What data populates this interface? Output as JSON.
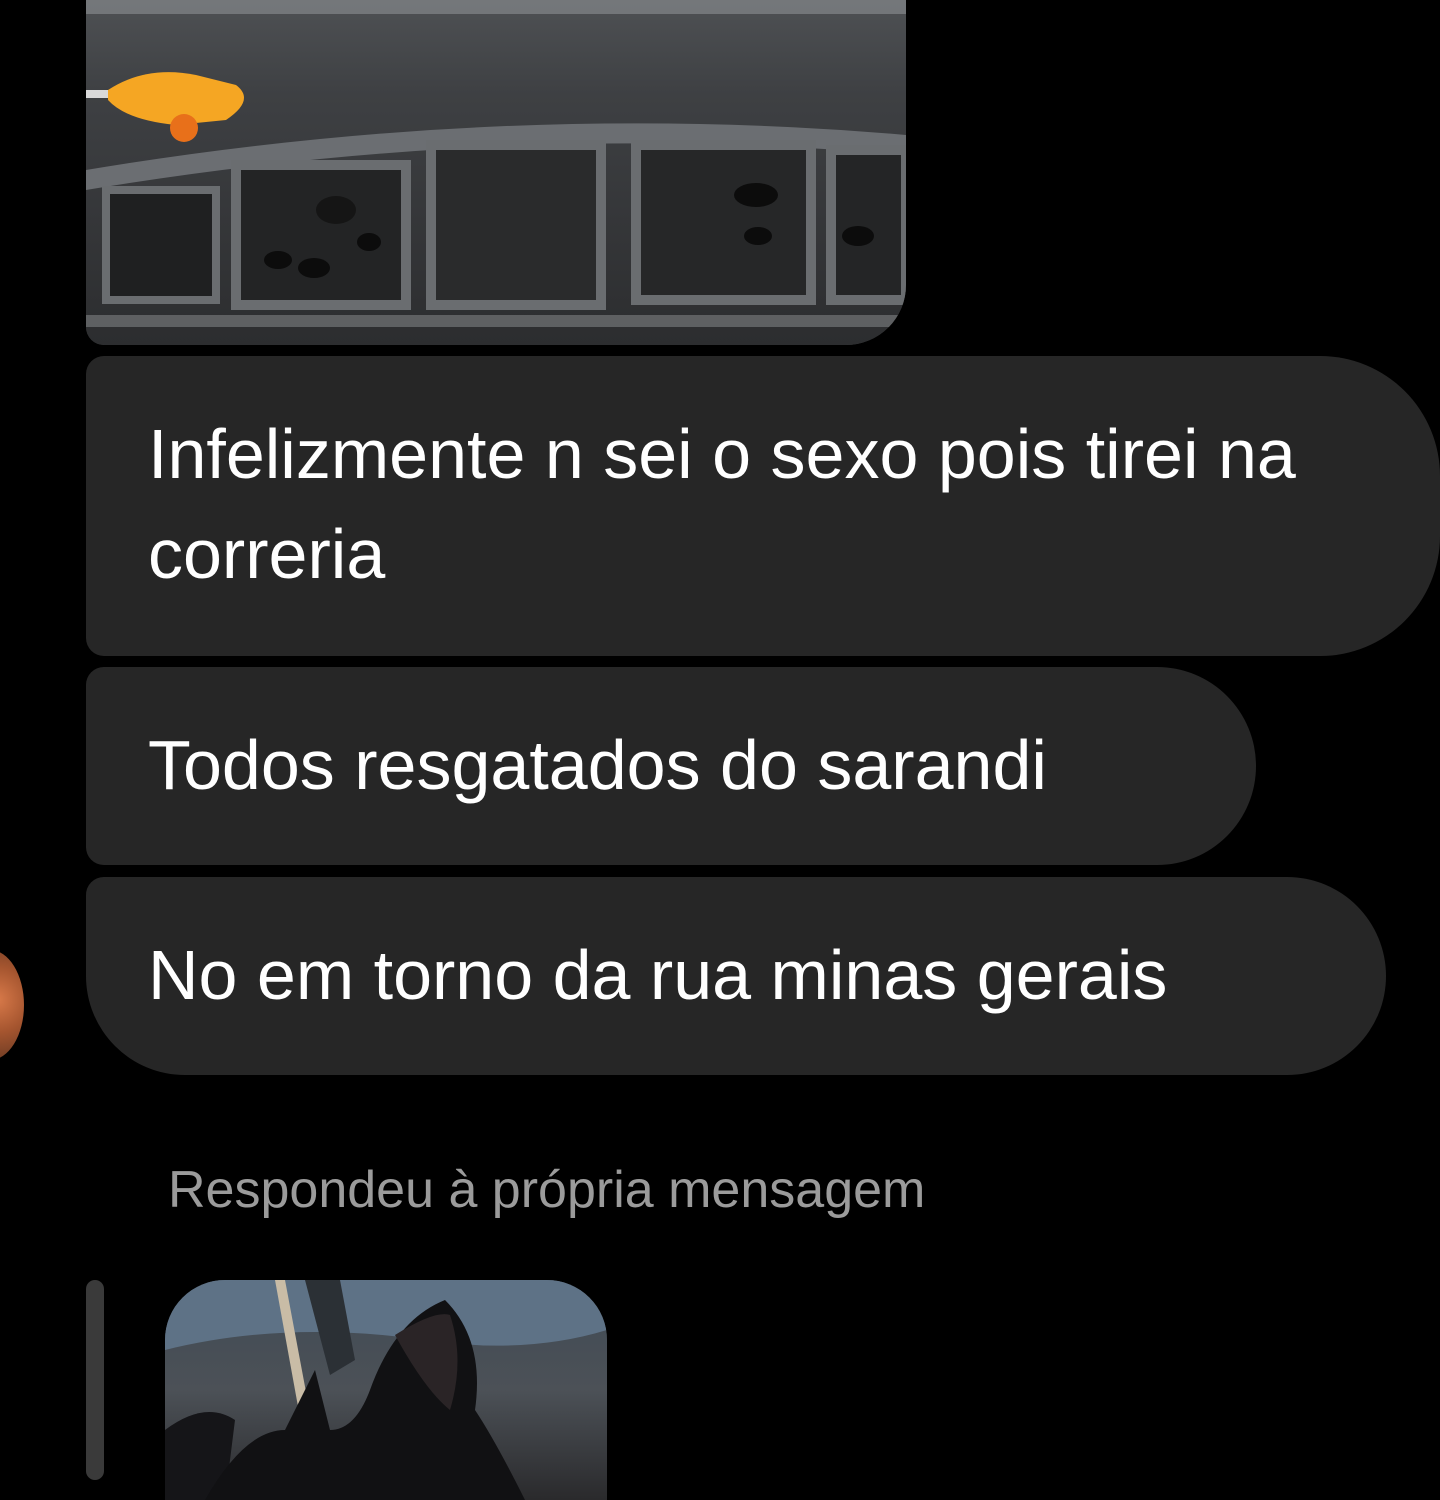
{
  "messages": [
    {
      "text": "Infelizmente n sei o sexo pois tirei na correria"
    },
    {
      "text": "Todos resgatados do sarandi"
    },
    {
      "text": "No em torno da rua minas gerais"
    }
  ],
  "reply": {
    "label": "Respondeu à própria mensagem"
  },
  "colors": {
    "background": "#000000",
    "bubble": "#262626",
    "text": "#ffffff",
    "muted_text": "#9b9b9b"
  }
}
